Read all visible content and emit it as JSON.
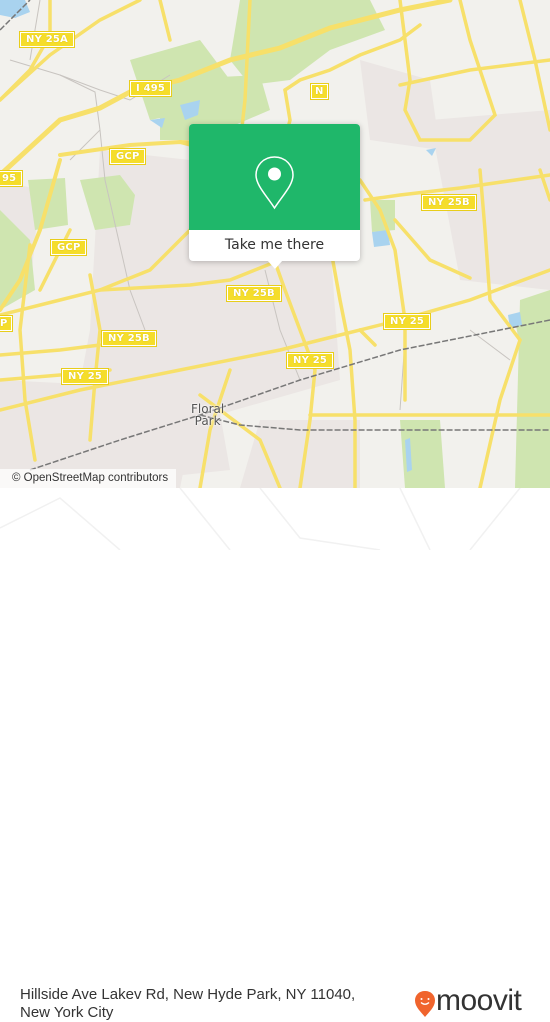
{
  "map": {
    "road_shields": [
      {
        "label": "NY 25A"
      },
      {
        "label": "I 495"
      },
      {
        "label": "N"
      },
      {
        "label": "GCP"
      },
      {
        "label": "95"
      },
      {
        "label": "GCP"
      },
      {
        "label": "P"
      },
      {
        "label": "NY 25B"
      },
      {
        "label": "NY 25B"
      },
      {
        "label": "NY 25B"
      },
      {
        "label": "NY 25"
      },
      {
        "label": "NY 25"
      },
      {
        "label": "NY 25"
      }
    ],
    "place_labels": [
      {
        "label": "Floral\nPark",
        "line1": "Floral",
        "line2": "Park"
      }
    ],
    "colors": {
      "background": "#f2f1ed",
      "road": "#f7e06a",
      "park": "#cfe5b0",
      "water": "#a9d3ef",
      "urban": "#ebe6e4",
      "rail": "#777777"
    }
  },
  "popup": {
    "icon": "map-pin-icon",
    "cta_label": "Take me there",
    "accent_color": "#1fb76a"
  },
  "attribution": "© OpenStreetMap contributors",
  "footer": {
    "address_line1": "Hillside Ave Lakev Rd, New Hyde Park, NY 11040,",
    "address_line2": "New York City",
    "brand": {
      "name": "moovit",
      "icon": "moovit-pin-logo-icon",
      "color": "#f0642d"
    }
  }
}
